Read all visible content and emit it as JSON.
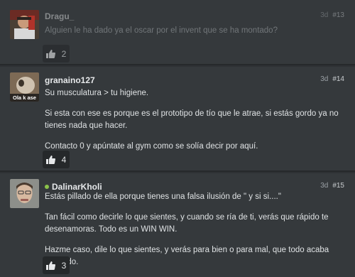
{
  "posts": [
    {
      "author": "Dragu_",
      "time": "3d",
      "number": "#13",
      "paragraphs": [
        "Alguien le ha dado ya el oscar por el invent que se ha montado?"
      ],
      "likes": "2",
      "online": false
    },
    {
      "author": "granaino127",
      "time": "3d",
      "number": "#14",
      "avatar_caption": "Ola k ase",
      "paragraphs": [
        "Su musculatura > tu higiene.",
        "Si esta con ese es porque es el prototipo de tío que le atrae, si estás gordo ya no tienes nada que hacer.",
        "Contacto 0 y apúntate al gym como se solía decir por aquí."
      ],
      "likes": "4",
      "online": false
    },
    {
      "author": "DalinarKholi",
      "time": "3d",
      "number": "#15",
      "paragraphs": [
        "Estás pillado de ella porque tienes una falsa ilusión de \" y si si....\"",
        "Tan fácil como decirle lo que sientes, y cuando se ría de ti, verás que rápido te desenamoras. Todo es un WIN WIN.",
        "Hazme caso, dile lo que sientes, y verás para bien o para mal, que todo acaba pasando."
      ],
      "likes": "3",
      "online": true
    }
  ],
  "icons": {
    "like": "thumbs-up-icon",
    "online": "online-status-dot"
  },
  "colors": {
    "background": "#2e3134",
    "post_background": "#35393c",
    "online": "#8bc34a",
    "button_background": "#25282a"
  }
}
